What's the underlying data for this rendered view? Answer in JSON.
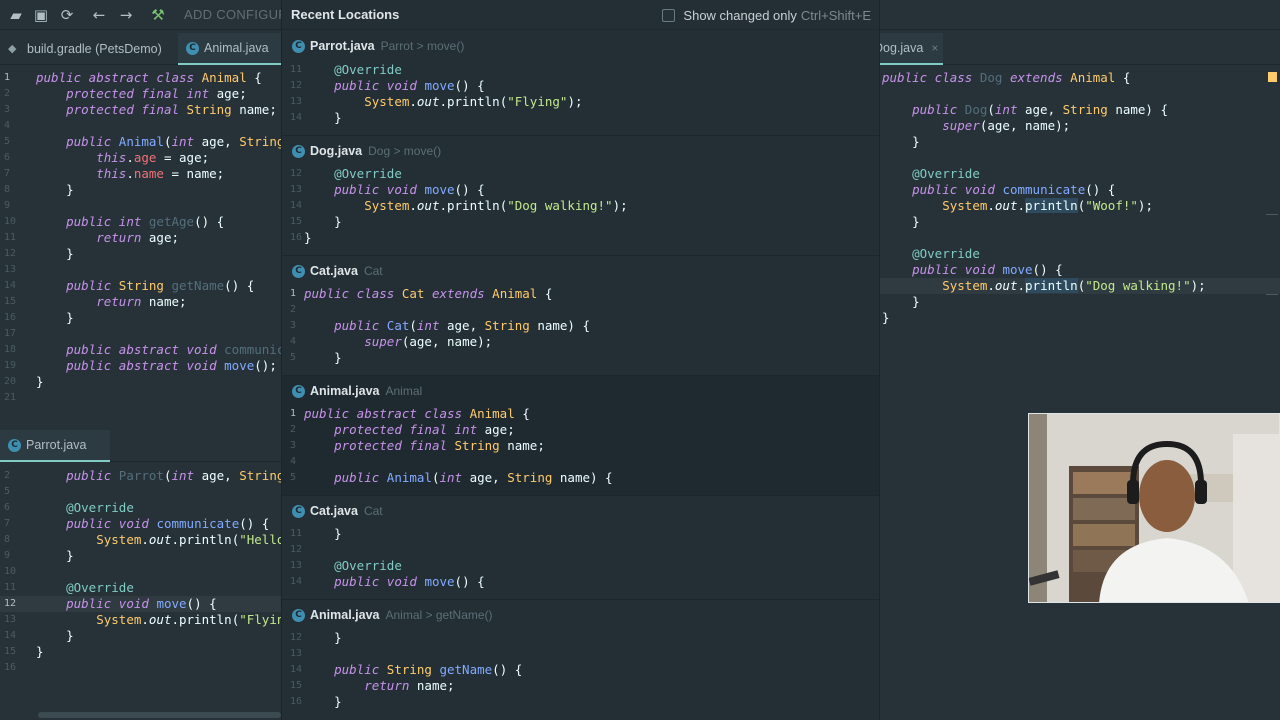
{
  "toolbar": {
    "add_config": "ADD CONFIGURA"
  },
  "left_tabs": {
    "tab1": "build.gradle (PetsDemo)",
    "tab2": "Animal.java"
  },
  "left_bottom_tabs": {
    "tab1": "Parrot.java"
  },
  "right_tabs": {
    "tab1": "Dog.java"
  },
  "popup": {
    "title": "Recent Locations",
    "show_changed": "Show changed only",
    "shortcut": "Ctrl+Shift+E",
    "sections": [
      {
        "file": "Parrot.java",
        "loc": "Parrot > move()"
      },
      {
        "file": "Dog.java",
        "loc": "Dog > move()"
      },
      {
        "file": "Cat.java",
        "loc": "Cat"
      },
      {
        "file": "Animal.java",
        "loc": "Animal"
      },
      {
        "file": "Cat.java",
        "loc": "Cat"
      },
      {
        "file": "Animal.java",
        "loc": "Animal > getName()"
      }
    ]
  },
  "colors": {
    "bg": "#263238",
    "accent": "#80cbc4",
    "keyword": "#c792ea",
    "type": "#ffcb6b",
    "string": "#c3e88d",
    "function": "#82aaff"
  },
  "icons": {
    "open": "folder-icon",
    "save": "save-icon",
    "sync": "sync-icon",
    "back": "arrow-left-icon",
    "forward": "arrow-right-icon",
    "build": "hammer-icon"
  }
}
